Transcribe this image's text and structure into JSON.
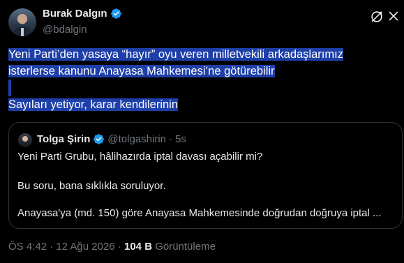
{
  "author": {
    "name": "Burak Dalgın",
    "handle": "@bdalgin"
  },
  "tweet": {
    "line1": "Yeni Parti’den yasaya “hayır” oyu veren milletvekili arkadaşlarımız",
    "line2": "isterlerse kanunu Anayasa Mahkemesi’ne götürebilir",
    "line3": "Sayıları yetiyor, karar kendilerinin"
  },
  "quote": {
    "name": "Tolga Şirin",
    "handle": "@tolgashirin",
    "separator": "·",
    "time": "5s",
    "line1": "Yeni Parti Grubu, hâlihazırda iptal davası açabilir mi?",
    "line2": "Bu soru, bana sıklıkla soruluyor.",
    "line3": "Anayasa'ya (md. 150) göre Anayasa Mahkemesinde doğrudan doğruya iptal ..."
  },
  "footer": {
    "time": "ÖS 4:42",
    "separator1": " · ",
    "date": "12 Ağu 2026",
    "separator2": " · ",
    "views_count": "104 B",
    "views_label": " Görüntüleme"
  },
  "colors": {
    "background": "#000000",
    "text": "#e7e9ea",
    "muted": "#71767b",
    "selection": "#1f3fa8",
    "verified": "#1d9bf0",
    "border": "#2f3336"
  },
  "icons": {
    "verified": "verified-badge-icon",
    "grok": "grok-icon",
    "close": "close-icon"
  }
}
